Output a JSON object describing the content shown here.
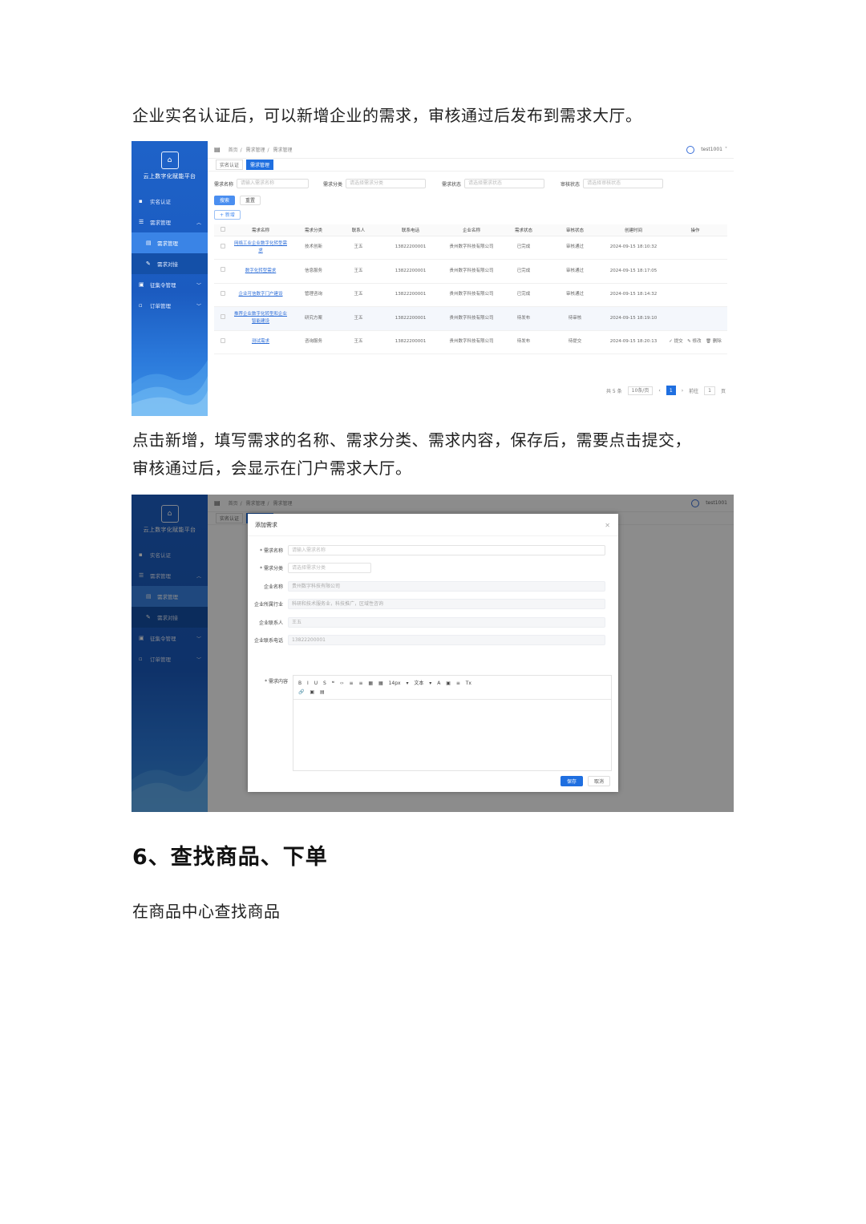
{
  "text": {
    "p1": "企业实名认证后，可以新增企业的需求，审核通过后发布到需求大厅。",
    "p2_line1": "点击新增，填写需求的名称、需求分类、需求内容，保存后，需要点击提交，",
    "p2_line2": "审核通过后，会显示在门户需求大厅。",
    "h6": "6、查找商品、下单",
    "p3": "在商品中心查找商品"
  },
  "app": {
    "platform_name": "云上数字化赋能平台",
    "nav": [
      {
        "label": "实名认证",
        "icon": "id-card-icon"
      },
      {
        "label": "需求管理",
        "icon": "list-icon",
        "expandable": true
      },
      {
        "label": "需求管理",
        "icon": "doc-icon",
        "sub": true,
        "active": true
      },
      {
        "label": "需求对接",
        "icon": "edit-icon",
        "sub": true
      },
      {
        "label": "征集令管理",
        "icon": "folder-icon",
        "expandable": true
      },
      {
        "label": "订单管理",
        "icon": "cart-icon",
        "expandable": true
      }
    ],
    "breadcrumb": [
      "首页",
      "需求管理",
      "需求管理"
    ],
    "user": "test1001",
    "tags": [
      "实名认证",
      "需求管理"
    ],
    "filters": {
      "name_label": "需求名称",
      "name_ph": "请输入需求名称",
      "cat_label": "需求分类",
      "cat_ph": "请选择需求分类",
      "status_label": "需求状态",
      "status_ph": "请选择需求状态",
      "audit_label": "审核状态",
      "audit_ph": "请选择审核状态"
    },
    "buttons": {
      "search": "搜索",
      "reset": "重置",
      "add": "+ 新增"
    },
    "columns": [
      "",
      "需求名称",
      "需求分类",
      "联系人",
      "联系电话",
      "企业名称",
      "需求状态",
      "审核状态",
      "创建时间",
      "操作"
    ],
    "rows": [
      {
        "name": "网络工业企业数字化转型需求",
        "cat": "技术创新",
        "contact": "王五",
        "phone": "13822200001",
        "company": "贵州数字科技有限公司",
        "status": "已完成",
        "audit": "审核通过",
        "time": "2024-09-15 18:10:32",
        "ops": ""
      },
      {
        "name": "数字化转型需求",
        "cat": "信息服务",
        "contact": "王五",
        "phone": "13822200001",
        "company": "贵州数字科技有限公司",
        "status": "已完成",
        "audit": "审核通过",
        "time": "2024-09-15 18:17:05",
        "ops": ""
      },
      {
        "name": "企业可信数字门户建设",
        "cat": "管理咨询",
        "contact": "王五",
        "phone": "13822200001",
        "company": "贵州数字科技有限公司",
        "status": "已完成",
        "audit": "审核通过",
        "time": "2024-09-15 18:14:32",
        "ops": ""
      },
      {
        "name": "推荐企业数字化转型和企业智能建设",
        "cat": "研究方案",
        "contact": "王五",
        "phone": "13822200001",
        "company": "贵州数字科技有限公司",
        "status": "待发布",
        "audit": "待审核",
        "time": "2024-09-15 18:19:10",
        "ops": ""
      },
      {
        "name": "测试需求",
        "cat": "咨询服务",
        "contact": "王五",
        "phone": "13822200001",
        "company": "贵州数字科技有限公司",
        "status": "待发布",
        "audit": "待提交",
        "time": "2024-09-15 18:20:13",
        "ops": "✓ 提交　✎ 修改　🗑 删除"
      }
    ],
    "pager": {
      "total": "共 5 条",
      "size": "10条/页",
      "page": "1",
      "goto": "前往",
      "goto_page": "1",
      "unit": "页"
    }
  },
  "dialog": {
    "title": "添加需求",
    "fields": [
      {
        "label": "* 需求名称",
        "value": "请输入需求名称",
        "ro": false,
        "w": 396
      },
      {
        "label": "* 需求分类",
        "value": "请选择需求分类",
        "ro": false,
        "w": 104
      },
      {
        "label": "企业名称",
        "value": "贵州数字科技有限公司",
        "ro": true,
        "w": 396
      },
      {
        "label": "企业所属行业",
        "value": "科研和技术服务业，科技推广，区域性咨询",
        "ro": true,
        "w": 396
      },
      {
        "label": "企业联系人",
        "value": "王五",
        "ro": true,
        "w": 396
      },
      {
        "label": "企业联系电话",
        "value": "13822200001",
        "ro": true,
        "w": 396
      }
    ],
    "content_label": "* 需求内容",
    "toolbar": "B I U S ❝ ‹› ≡ ≡ ▦ ▦ 14px ▾ 文本 ▾ A ▣ ≡ Tx",
    "toolbar2": "🔗 ▣ ▤",
    "save": "保存",
    "cancel": "取消"
  },
  "colors": {
    "sidebar": "#1e62c8",
    "primary": "#1f6fe0"
  }
}
